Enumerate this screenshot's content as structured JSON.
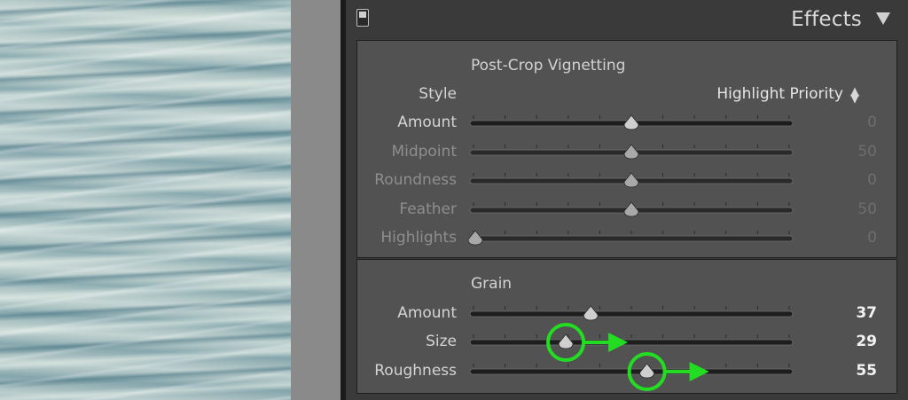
{
  "panel": {
    "title": "Effects",
    "collapse_icon": "triangle-down-icon"
  },
  "vignetting": {
    "title": "Post-Crop Vignetting",
    "style_label": "Style",
    "style_value": "Highlight Priority",
    "rows": [
      {
        "label": "Amount",
        "value": "0",
        "position": 0.5,
        "enabled": true
      },
      {
        "label": "Midpoint",
        "value": "50",
        "position": 0.5,
        "enabled": false
      },
      {
        "label": "Roundness",
        "value": "0",
        "position": 0.5,
        "enabled": false
      },
      {
        "label": "Feather",
        "value": "50",
        "position": 0.5,
        "enabled": false
      },
      {
        "label": "Highlights",
        "value": "0",
        "position": 0.0,
        "enabled": false
      }
    ]
  },
  "grain": {
    "title": "Grain",
    "rows": [
      {
        "label": "Amount",
        "value": "37",
        "position": 0.37
      },
      {
        "label": "Size",
        "value": "29",
        "position": 0.29
      },
      {
        "label": "Roughness",
        "value": "55",
        "position": 0.55
      }
    ]
  },
  "annotations": {
    "color": "#22dd22",
    "highlighted_rows": [
      "Size",
      "Roughness"
    ]
  }
}
